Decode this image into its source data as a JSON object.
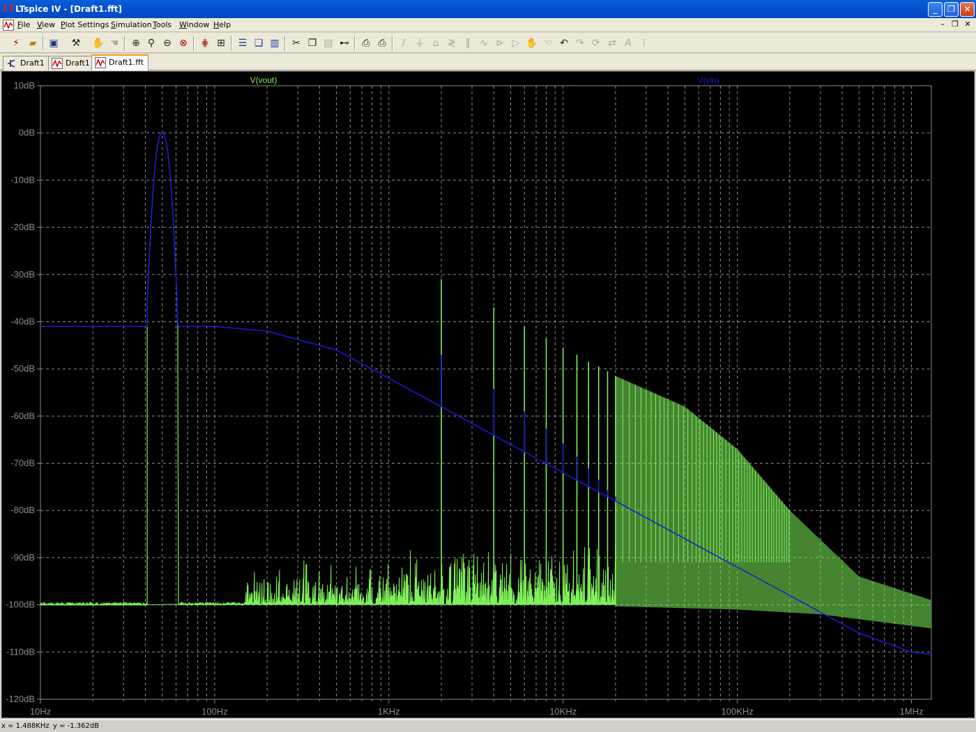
{
  "window": {
    "title": "LTspice IV - [Draft1.fft]",
    "app_icon": "ltspice-logo-icon",
    "buttons": [
      "minimize",
      "maximize",
      "close"
    ]
  },
  "menu": {
    "items": [
      "File",
      "View",
      "Plot Settings",
      "Simulation",
      "Tools",
      "Window",
      "Help"
    ]
  },
  "toolbar": {
    "buttons": [
      "run-icon",
      "open-icon",
      "save-icon",
      "control-panel-icon",
      "halt-icon",
      "pan-icon",
      "zoom-in-icon",
      "zoom-out-icon",
      "zoom-back-icon",
      "zoom-fit-icon",
      "autorange-icon",
      "fft-icon",
      "tile-horizontal-icon",
      "cascade-icon",
      "tile-vertical-icon",
      "cut-icon",
      "copy-icon",
      "paste-icon",
      "find-icon",
      "print-setup-icon",
      "print-icon",
      "wire-icon",
      "ground-icon",
      "label-icon",
      "resistor-icon",
      "capacitor-icon",
      "inductor-icon",
      "diode-icon",
      "component-icon",
      "move-icon",
      "drag-icon",
      "undo-icon",
      "redo-icon",
      "rotate-icon",
      "mirror-icon",
      "text-icon",
      "spice-directive-icon"
    ]
  },
  "tabs": [
    {
      "label": "Draft1",
      "icon": "schematic-icon",
      "active": false
    },
    {
      "label": "Draft1",
      "icon": "waveform-icon",
      "active": false
    },
    {
      "label": "Draft1.fft",
      "icon": "fft-waveform-icon",
      "active": true
    }
  ],
  "status": {
    "x_readout": "x = 1.488KHz",
    "y_readout": "y = -1.362dB"
  },
  "chart_data": {
    "type": "line",
    "title": "",
    "xlabel": "",
    "ylabel": "",
    "x_scale": "log",
    "xlim": [
      10,
      1300000
    ],
    "ylim": [
      -120,
      10
    ],
    "grid": true,
    "x_tick_values": [
      10,
      100,
      1000,
      10000,
      100000,
      1000000
    ],
    "x_tick_labels": [
      "10Hz",
      "100Hz",
      "1KHz",
      "10KHz",
      "100KHz",
      "1MHz"
    ],
    "y_tick_values": [
      10,
      0,
      -10,
      -20,
      -30,
      -40,
      -50,
      -60,
      -70,
      -80,
      -90,
      -100,
      -110,
      -120
    ],
    "y_tick_labels": [
      "10dB",
      "0dB",
      "-10dB",
      "-20dB",
      "-30dB",
      "-40dB",
      "-50dB",
      "-60dB",
      "-70dB",
      "-80dB",
      "-90dB",
      "-100dB",
      "-110dB",
      "-120dB"
    ],
    "background": "#000000",
    "grid_color": "#8c8c8c",
    "series": [
      {
        "name": "V(vout)",
        "color": "#7ef05a",
        "legend_position": "top-left",
        "noise_floor_db": -100,
        "fundamental_peak": {
          "x": 50,
          "y": 0,
          "x_range": [
            41,
            62
          ]
        },
        "harmonics": [
          {
            "x": 2000,
            "y": -31
          },
          {
            "x": 4000,
            "y": -37
          },
          {
            "x": 6000,
            "y": -41
          },
          {
            "x": 8000,
            "y": -43.5
          },
          {
            "x": 10000,
            "y": -45.5
          },
          {
            "x": 12000,
            "y": -47
          },
          {
            "x": 14000,
            "y": -48.5
          },
          {
            "x": 16000,
            "y": -49.5
          },
          {
            "x": 18000,
            "y": -50.5
          },
          {
            "x": 20000,
            "y": -51.5
          }
        ],
        "envelope_upper": [
          {
            "x": 20000,
            "y": -51.5
          },
          {
            "x": 50000,
            "y": -58
          },
          {
            "x": 100000,
            "y": -67
          },
          {
            "x": 200000,
            "y": -80
          },
          {
            "x": 500000,
            "y": -94
          },
          {
            "x": 1300000,
            "y": -99
          }
        ],
        "envelope_lower": [
          {
            "x": 10000,
            "y": -100
          },
          {
            "x": 100000,
            "y": -101
          },
          {
            "x": 300000,
            "y": -102
          },
          {
            "x": 1300000,
            "y": -105
          }
        ]
      },
      {
        "name": "V(vin)",
        "color": "#1a1ad8",
        "legend_position": "top-right",
        "points": [
          {
            "x": 10,
            "y": -41
          },
          {
            "x": 41,
            "y": -41
          },
          {
            "x": 50,
            "y": 0
          },
          {
            "x": 62,
            "y": -41
          },
          {
            "x": 100,
            "y": -41
          },
          {
            "x": 200,
            "y": -42
          },
          {
            "x": 500,
            "y": -46
          },
          {
            "x": 1000,
            "y": -52
          },
          {
            "x": 2000,
            "y": -58
          },
          {
            "x": 5000,
            "y": -66
          },
          {
            "x": 10000,
            "y": -72
          },
          {
            "x": 20000,
            "y": -78
          },
          {
            "x": 50000,
            "y": -86
          },
          {
            "x": 100000,
            "y": -92
          },
          {
            "x": 200000,
            "y": -98
          },
          {
            "x": 500000,
            "y": -106
          },
          {
            "x": 1000000,
            "y": -110
          },
          {
            "x": 1300000,
            "y": -110.5
          }
        ]
      }
    ]
  }
}
